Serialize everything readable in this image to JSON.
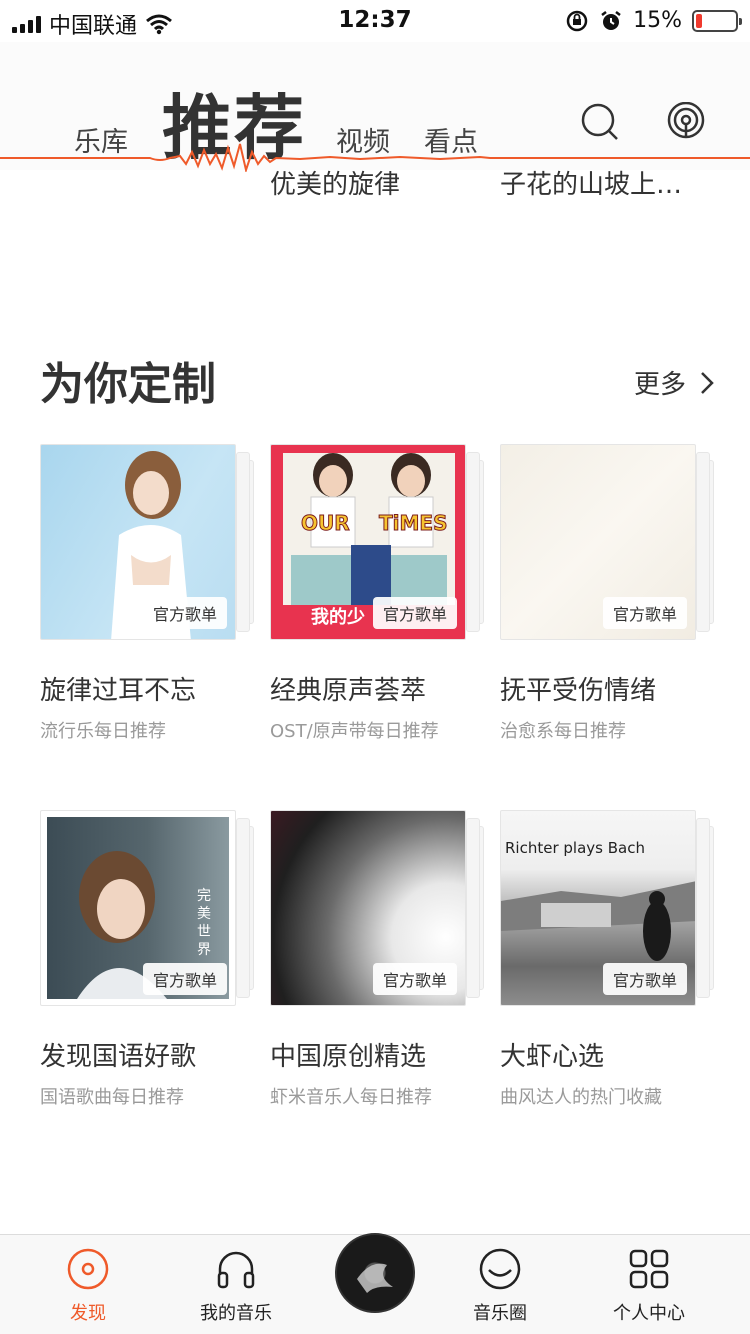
{
  "status_bar": {
    "carrier": "中国联通",
    "time": "12:37",
    "battery": "15%",
    "battery_level": 0.15
  },
  "header": {
    "tabs": [
      {
        "label": "乐库"
      },
      {
        "label": "推荐"
      },
      {
        "label": "视频"
      },
      {
        "label": "看点"
      }
    ],
    "search_icon": "search-icon",
    "radio_icon": "broadcast-icon",
    "accent": "#ef5a2a"
  },
  "previous_row": {
    "titles": [
      "优美的旋律",
      "子花的山坡上…"
    ]
  },
  "section": {
    "title": "为你定制",
    "more_label": "更多"
  },
  "cards": [
    {
      "title": "旋律过耳不忘",
      "subtitle": "流行乐每日推荐",
      "badge": "官方歌单"
    },
    {
      "title": "经典原声荟萃",
      "subtitle": "OST/原声带每日推荐",
      "badge": "官方歌单",
      "cover_text_1": "OUR",
      "cover_text_2": "TiMES",
      "cover_text_3": "我的少"
    },
    {
      "title": "抚平受伤情绪",
      "subtitle": "治愈系每日推荐",
      "badge": "官方歌单"
    },
    {
      "title": "发现国语好歌",
      "subtitle": "国语歌曲每日推荐",
      "badge": "官方歌单",
      "cover_text_1": "完美世界"
    },
    {
      "title": "中国原创精选",
      "subtitle": "虾米音乐人每日推荐",
      "badge": "官方歌单"
    },
    {
      "title": "大虾心选",
      "subtitle": "曲风达人的热门收藏",
      "badge": "官方歌单",
      "cover_text_1": "Richter plays Bach"
    }
  ],
  "bottom_nav": [
    {
      "label": "发现",
      "icon": "discover-icon"
    },
    {
      "label": "我的音乐",
      "icon": "headphones-icon"
    },
    {
      "label": "",
      "icon": "now-playing-disc"
    },
    {
      "label": "音乐圈",
      "icon": "smile-icon"
    },
    {
      "label": "个人中心",
      "icon": "grid-icon"
    }
  ]
}
